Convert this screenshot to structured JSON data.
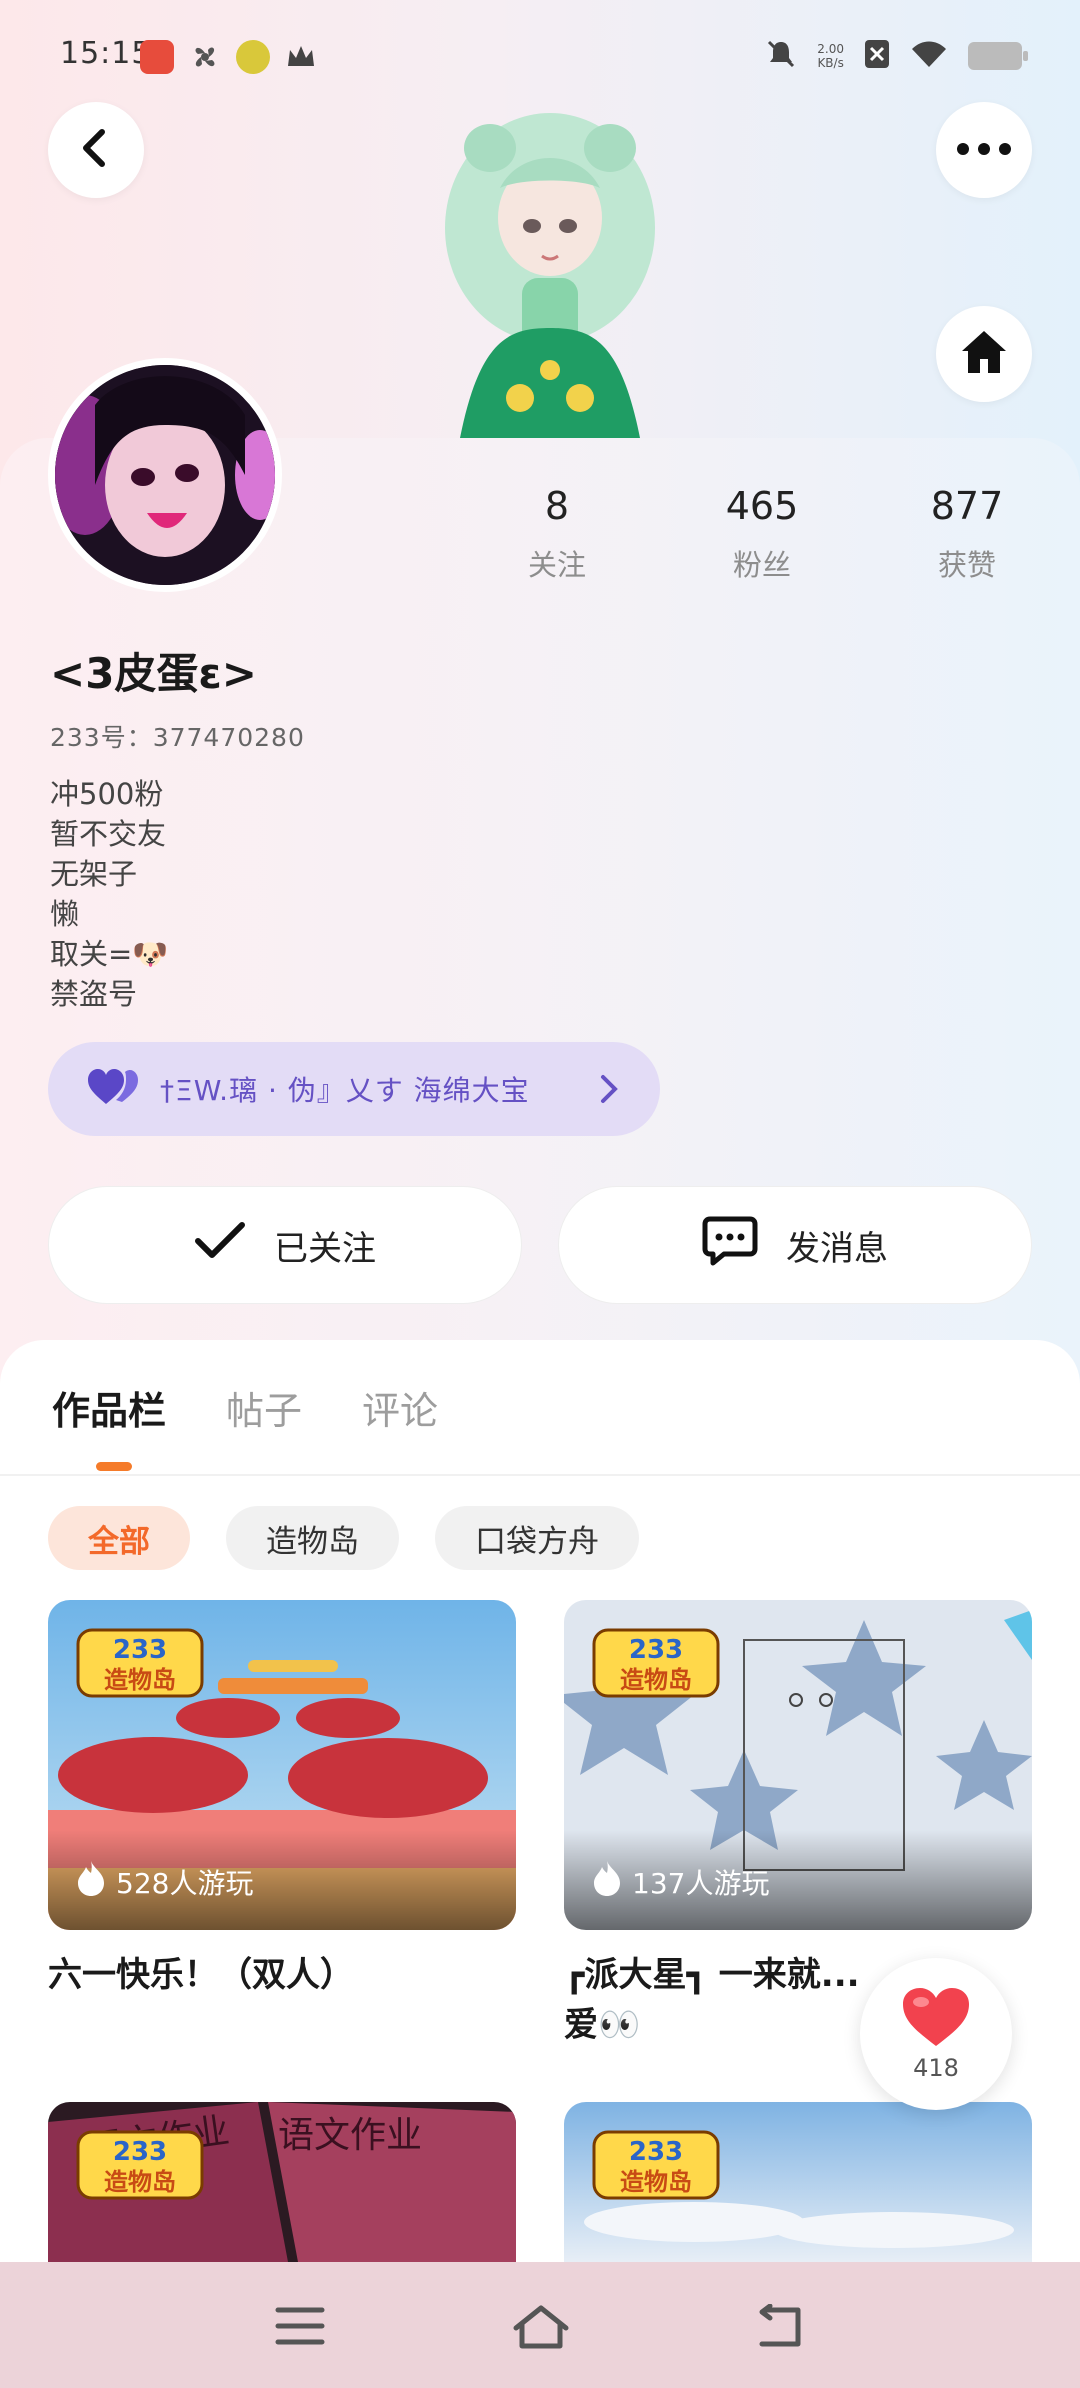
{
  "status_bar": {
    "time": "15:15",
    "net_speed_value": "2.00",
    "net_speed_unit": "KB/s"
  },
  "profile": {
    "nickname": "<3皮蛋ε>",
    "uid": "233号：377470280",
    "stats": [
      {
        "value": "8",
        "label": "关注"
      },
      {
        "value": "465",
        "label": "粉丝"
      },
      {
        "value": "877",
        "label": "获赞"
      }
    ],
    "bio": [
      "冲500粉",
      "暂不交友",
      "无架子",
      "懒",
      "取关=🐶",
      "禁盗号"
    ],
    "team_pill": "†ΞW.璃 · 伪』乂す 海绵大宝"
  },
  "actions": {
    "followed_label": "已关注",
    "message_label": "发消息"
  },
  "tabs": [
    "作品栏",
    "帖子",
    "评论"
  ],
  "filters": [
    "全部",
    "造物岛",
    "口袋方舟"
  ],
  "badge_text": {
    "top": "233",
    "bottom": "造物岛"
  },
  "games": [
    {
      "title": "六一快乐！（双人）",
      "plays": "528人游玩"
    },
    {
      "title": "┏派大星┓ 一来就...爱👀",
      "plays": "137人游玩"
    },
    {
      "title": "",
      "plays": ""
    },
    {
      "title": "",
      "plays": ""
    }
  ],
  "third_thumb_text": [
    "语文作业",
    "语文作业"
  ],
  "like_fab": {
    "count": "418"
  },
  "colors": {
    "accent_orange": "#f57b2a",
    "team_purple": "#6551c4",
    "like_red": "#f2424e"
  }
}
